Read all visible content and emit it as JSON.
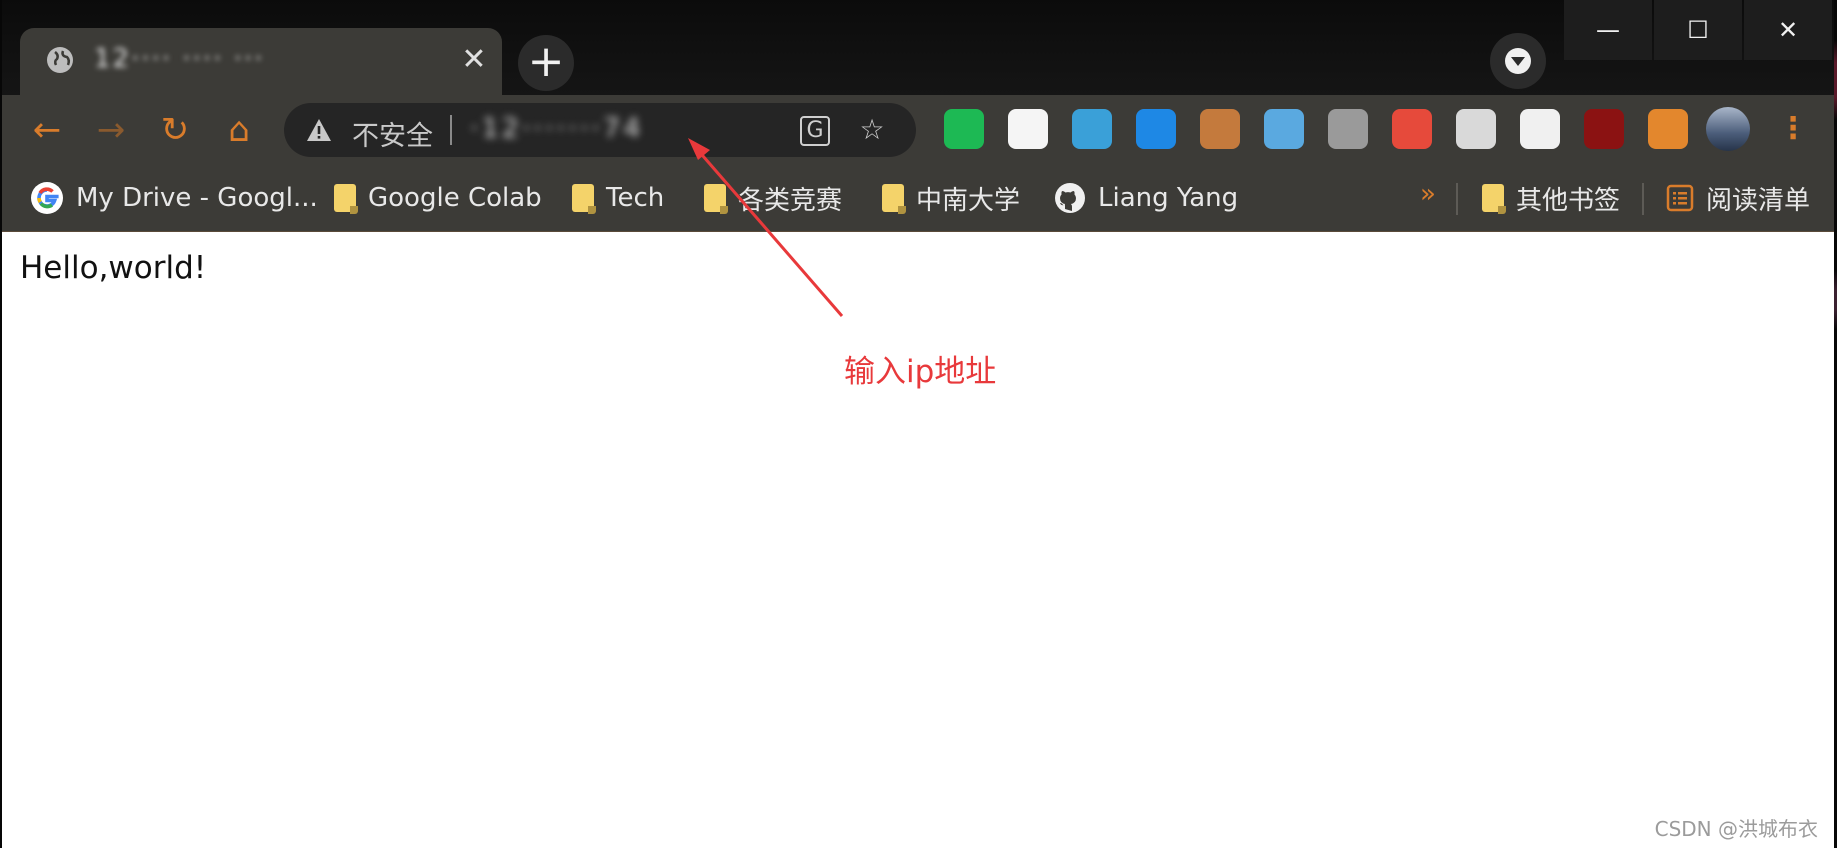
{
  "tab": {
    "title": "12···· ···· ···",
    "close": "✕"
  },
  "new_tab": "+",
  "window_controls": {
    "minimize": "—",
    "maximize": "☐",
    "close": "✕"
  },
  "nav": {
    "back": "←",
    "forward": "→",
    "reload": "↻",
    "home": "⌂"
  },
  "omnibox": {
    "security_label": "不安全",
    "url": "·12·······74"
  },
  "extensions": [
    {
      "name": "spotify-extension",
      "color": "#1db954"
    },
    {
      "name": "article-extension",
      "color": "#f5f5f5"
    },
    {
      "name": "fruit-extension",
      "color": "#3aa0d8"
    },
    {
      "name": "gem-extension",
      "color": "#1e88e5"
    },
    {
      "name": "glasses-extension",
      "color": "#c47a3d"
    },
    {
      "name": "vimium-extension",
      "color": "#5aa9e0"
    },
    {
      "name": "shield-extension",
      "color": "#9a9a9a"
    },
    {
      "name": "fish-extension",
      "color": "#e64a3b"
    },
    {
      "name": "folder-download-extension",
      "color": "#d9d9d9"
    },
    {
      "name": "cat-extension",
      "color": "#f0f0f0"
    },
    {
      "name": "ublock-extension",
      "color": "#8b1212"
    },
    {
      "name": "puzzle-extension",
      "color": "#e3872d"
    }
  ],
  "bookmarks": [
    {
      "label": "My Drive - Googl..."
    },
    {
      "label": "Google Colab"
    },
    {
      "label": "Tech"
    },
    {
      "label": "各类竞赛"
    },
    {
      "label": "中南大学"
    },
    {
      "label": "Liang Yang"
    }
  ],
  "bookmarks_overflow": "»",
  "other_bookmarks": "其他书签",
  "reading_list": "阅读清单",
  "page": {
    "content": "Hello,world!"
  },
  "annotation": {
    "text": "输入ip地址",
    "color": "#e8393b"
  },
  "watermark": "CSDN @洪城布衣"
}
